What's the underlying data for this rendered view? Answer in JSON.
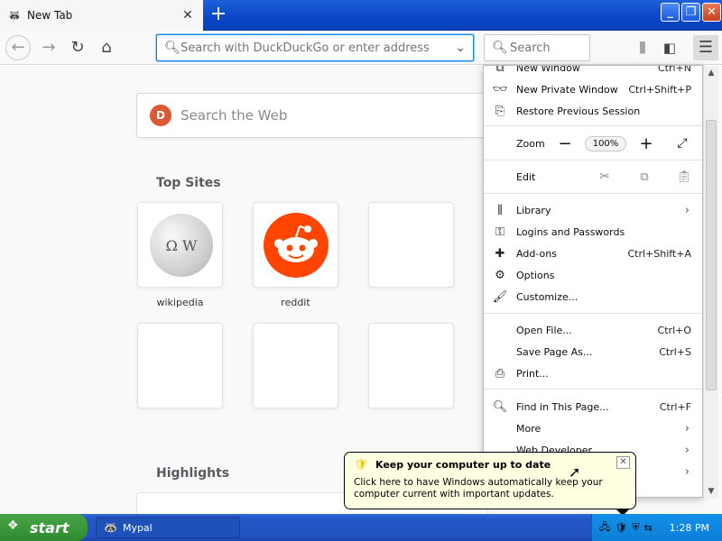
{
  "browser": {
    "tab": {
      "title": "New Tab",
      "favicon": "mypal-favicon",
      "close": "✕"
    },
    "new_tab_icon": "+",
    "window_buttons": {
      "minimize": "_",
      "maximize": "❐",
      "close": "✕"
    }
  },
  "toolbar": {
    "url_placeholder": "Search with DuckDuckGo or enter address",
    "search_placeholder": "Search"
  },
  "newtab": {
    "web_search_placeholder": "Search the Web",
    "top_sites_title": "Top Sites",
    "highlights_title": "Highlights",
    "top_sites": [
      {
        "label": "wikipedia"
      },
      {
        "label": "reddit"
      }
    ]
  },
  "menu": {
    "new_window": {
      "label": "New Window",
      "shortcut": "Ctrl+N"
    },
    "new_private": {
      "label": "New Private Window",
      "shortcut": "Ctrl+Shift+P"
    },
    "restore": {
      "label": "Restore Previous Session"
    },
    "zoom": {
      "label": "Zoom",
      "value": "100%"
    },
    "edit": {
      "label": "Edit"
    },
    "library": {
      "label": "Library"
    },
    "logins": {
      "label": "Logins and Passwords"
    },
    "addons": {
      "label": "Add-ons",
      "shortcut": "Ctrl+Shift+A"
    },
    "options": {
      "label": "Options"
    },
    "customize": {
      "label": "Customize..."
    },
    "open_file": {
      "label": "Open File...",
      "shortcut": "Ctrl+O"
    },
    "save_page": {
      "label": "Save Page As...",
      "shortcut": "Ctrl+S"
    },
    "print": {
      "label": "Print..."
    },
    "find": {
      "label": "Find in This Page...",
      "shortcut": "Ctrl+F"
    },
    "more": {
      "label": "More"
    },
    "web_developer": {
      "label": "Web Developer"
    }
  },
  "balloon": {
    "title": "Keep your computer up to date",
    "text": "Click here to have Windows automatically keep your computer current with important updates."
  },
  "taskbar": {
    "start": "start",
    "task": "Mypal",
    "clock": "1:28 PM"
  }
}
